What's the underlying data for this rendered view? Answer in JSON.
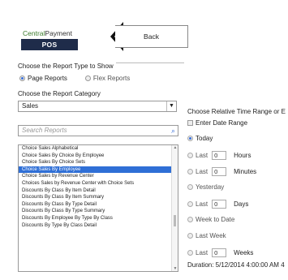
{
  "header": {
    "logo_line1_a": "Central",
    "logo_line1_b": "Payment",
    "logo_line2": "POS SOLUTIONS",
    "back_label": "Back"
  },
  "report_type": {
    "title": "Choose the Report Type to Show",
    "options": [
      "Page Reports",
      "Flex Reports"
    ],
    "selected": "Page Reports"
  },
  "category": {
    "label": "Choose the Report Category",
    "value": "Sales"
  },
  "search": {
    "placeholder": "Search Reports"
  },
  "reports": [
    "Choice Sales Alphabetical",
    "Choice Sales By Choice By Employee",
    "Choice Sales By Choice Sets",
    "Choice Sales By Employee",
    "Choice Sales by Revenue Center",
    "Choices Sales by Revenue Center with Choice Sets",
    "Discounts By Class By Item Detail",
    "Discounts By Class By Item Summary",
    "Discounts By Class By Type Detail",
    "Discounts By Class By Type Summary",
    "Discounts By Employee By Type By Class",
    "Discounts By Type By Class Detail"
  ],
  "selected_report": "Choice Sales By Employee",
  "time_range": {
    "title": "Choose Relative Time Range or E",
    "enter_date_range": "Enter Date Range",
    "options": {
      "today": "Today",
      "last_hours": {
        "prefix": "Last",
        "value": "0",
        "unit": "Hours"
      },
      "last_minutes": {
        "prefix": "Last",
        "value": "0",
        "unit": "Minutes"
      },
      "yesterday": "Yesterday",
      "last_days": {
        "prefix": "Last",
        "value": "0",
        "unit": "Days"
      },
      "week_to_date": "Week to Date",
      "last_week": "Last Week",
      "last_weeks": {
        "prefix": "Last",
        "value": "0",
        "unit": "Weeks"
      }
    },
    "selected": "Today",
    "duration": "Duration: 5/12/2014 4:00:00 AM 4"
  },
  "colors": {
    "accent": "#2f6fd6",
    "logo_bg": "#1f2c4a",
    "logo_green": "#3a7a2a"
  }
}
